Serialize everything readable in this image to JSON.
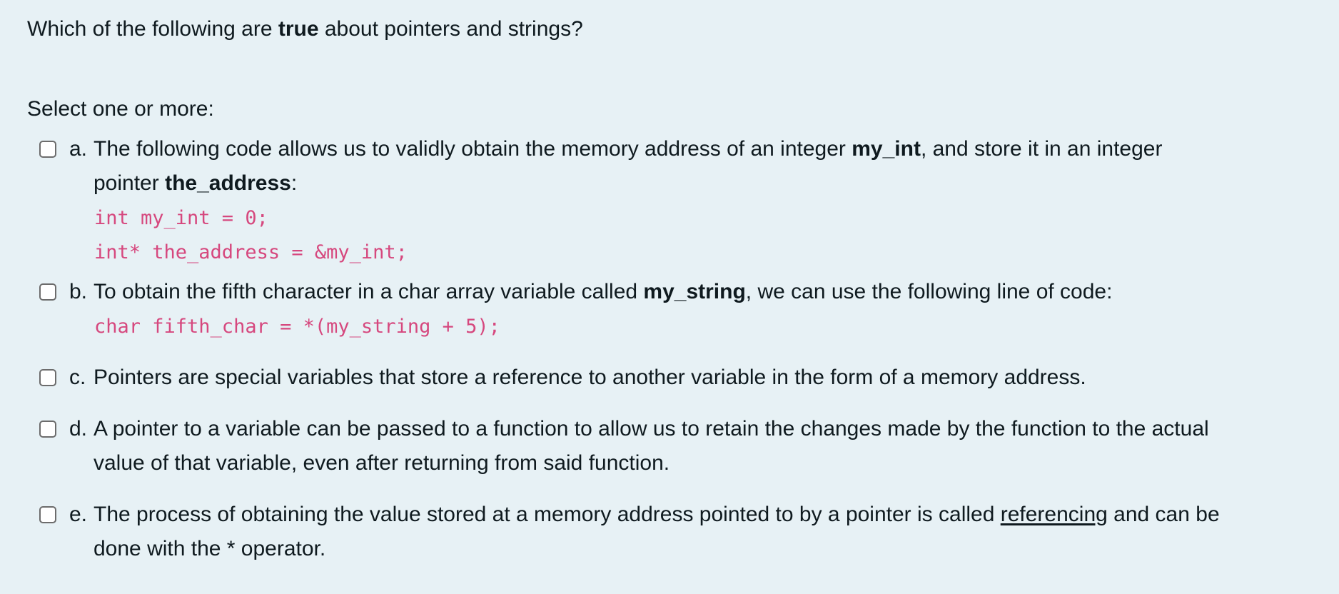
{
  "question": {
    "title_before": "Which of the following are ",
    "title_bold": "true",
    "title_after": " about pointers and strings?",
    "prompt": "Select one or more:"
  },
  "options": [
    {
      "letter": "a.",
      "checked": false,
      "line1_before": "The following code allows us to validly obtain the memory address of an integer ",
      "line1_bold": "my_int",
      "line1_after": ", and store it in an integer",
      "line2_before": "pointer ",
      "line2_bold": "the_address",
      "line2_after": ":",
      "code": [
        "int my_int = 0;",
        "int* the_address = &my_int;"
      ]
    },
    {
      "letter": "b.",
      "checked": false,
      "line1_before": "To obtain the fifth character in a char array variable called ",
      "line1_bold": "my_string",
      "line1_after": ", we can use the following line of code:",
      "code": [
        "char fifth_char = *(my_string + 5);"
      ]
    },
    {
      "letter": "c.",
      "checked": false,
      "line1": "Pointers are special variables that store a reference to another variable in the form of a memory address."
    },
    {
      "letter": "d.",
      "checked": false,
      "line1": "A pointer to a variable can be passed to a function to allow us to retain the changes made by the function to the actual",
      "line2": "value of that variable, even after returning from said function."
    },
    {
      "letter": "e.",
      "checked": false,
      "line1_before": "The process of obtaining the value stored at a memory address pointed to by a pointer is called ",
      "line1_underline": "referencing",
      "line1_after": " and can be",
      "line2": "done with the * operator."
    }
  ],
  "colors": {
    "background": "#e7f1f5",
    "text": "#0f1a1f",
    "code": "#d6487e"
  }
}
